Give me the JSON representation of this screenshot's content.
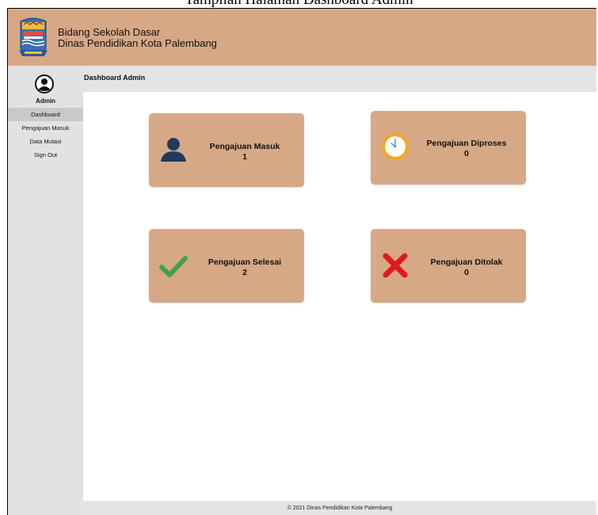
{
  "caption": "Tampilan Halaman Dashboard Admin",
  "header": {
    "line1": "Bidang Sekolah Dasar",
    "line2": "Dinas Pendidikan Kota Palembang"
  },
  "sidebar": {
    "user_label": "Admin",
    "items": [
      {
        "label": "Dashboard",
        "active": true
      },
      {
        "label": "Pengajuan Masuk"
      },
      {
        "label": "Data Mutasi"
      },
      {
        "label": "Sign Out"
      }
    ]
  },
  "page_title": "Dashboard Admin",
  "cards": [
    {
      "title": "Pengajuan Masuk",
      "count": "1",
      "icon": "user-icon"
    },
    {
      "title": "Pengajuan Diproses",
      "count": "0",
      "icon": "clock-icon"
    },
    {
      "title": "Pengajuan Selesai",
      "count": "2",
      "icon": "check-icon"
    },
    {
      "title": "Pengajuan Ditolak",
      "count": "0",
      "icon": "cross-icon"
    }
  ],
  "footer": "© 2021 Dinas Pendidikan Kota Palembang",
  "colors": {
    "header_bg": "#d7a886",
    "card_bg": "#d7a886",
    "sidebar_bg": "#e2e2e2",
    "check": "#3fa34d",
    "cross": "#e0181e",
    "clock": "#f5a623",
    "user": "#1f3a5c"
  }
}
